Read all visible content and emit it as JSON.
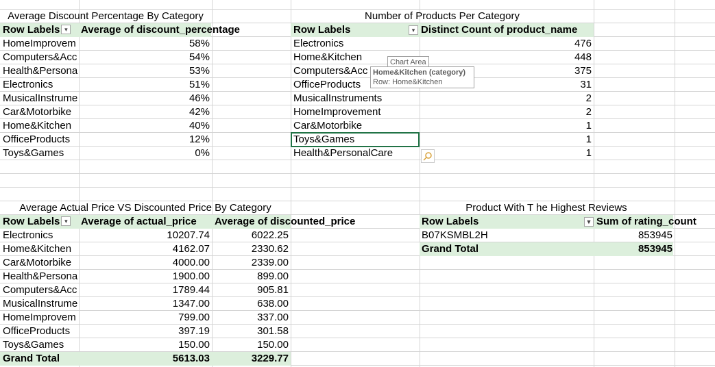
{
  "discount": {
    "title": "Average Discount Percentage By Category",
    "col1": "Row Labels",
    "col2": "Average of discount_percentage",
    "rows": [
      {
        "label": "HomeImprovem",
        "value": "58%"
      },
      {
        "label": "Computers&Acc",
        "value": "54%"
      },
      {
        "label": "Health&Persona",
        "value": "53%"
      },
      {
        "label": "Electronics",
        "value": "51%"
      },
      {
        "label": "MusicalInstrume",
        "value": "46%"
      },
      {
        "label": "Car&Motorbike",
        "value": "42%"
      },
      {
        "label": "Home&Kitchen",
        "value": "40%"
      },
      {
        "label": "OfficeProducts",
        "value": "12%"
      },
      {
        "label": "Toys&Games",
        "value": "0%"
      }
    ]
  },
  "products": {
    "title": "Number of Products Per Category",
    "col1": "Row Labels",
    "col2": "Distinct Count of product_name",
    "rows": [
      {
        "label": "Electronics",
        "value": "476"
      },
      {
        "label": "Home&Kitchen",
        "value": "448"
      },
      {
        "label": "Computers&Acc",
        "value": "375"
      },
      {
        "label": "OfficeProducts",
        "value": "31"
      },
      {
        "label": "MusicalInstruments",
        "value": "2"
      },
      {
        "label": "HomeImprovement",
        "value": "2"
      },
      {
        "label": "Car&Motorbike",
        "value": "1"
      },
      {
        "label": "Toys&Games",
        "value": "1"
      },
      {
        "label": "Health&PersonalCare",
        "value": "1"
      }
    ]
  },
  "tooltip": {
    "chart_area": "Chart Area",
    "series": "Home&Kitchen (category)",
    "row": "Row: Home&Kitchen"
  },
  "prices": {
    "title": "Average Actual Price VS Discounted Price By Category",
    "col1": "Row Labels",
    "col2": "Average of actual_price",
    "col3": "Average of discounted_price",
    "rows": [
      {
        "label": "Electronics",
        "actual": "10207.74",
        "disc": "6022.25"
      },
      {
        "label": "Home&Kitchen",
        "actual": "4162.07",
        "disc": "2330.62"
      },
      {
        "label": "Car&Motorbike",
        "actual": "4000.00",
        "disc": "2339.00"
      },
      {
        "label": "Health&Persona",
        "actual": "1900.00",
        "disc": "899.00"
      },
      {
        "label": "Computers&Acc",
        "actual": "1789.44",
        "disc": "905.81"
      },
      {
        "label": "MusicalInstrume",
        "actual": "1347.00",
        "disc": "638.00"
      },
      {
        "label": "HomeImprovem",
        "actual": "799.00",
        "disc": "337.00"
      },
      {
        "label": "OfficeProducts",
        "actual": "397.19",
        "disc": "301.58"
      },
      {
        "label": "Toys&Games",
        "actual": "150.00",
        "disc": "150.00"
      }
    ],
    "total_label": "Grand Total",
    "total_actual": "5613.03",
    "total_disc": "3229.77"
  },
  "reviews": {
    "title": "Product With T he Highest Reviews",
    "col1": "Row Labels",
    "col2": "Sum of rating_count",
    "row_label": "B07KSMBL2H",
    "row_value": "853945",
    "total_label": "Grand Total",
    "total_value": "853945"
  },
  "icons": {
    "filter": "dropdown-filter-icon",
    "filtered": "active-filter-icon",
    "quick_explore": "magnifier-icon"
  },
  "colors": {
    "header_fill": "#dcefdc",
    "selection": "#217346",
    "gridline": "#d4d4d4"
  }
}
